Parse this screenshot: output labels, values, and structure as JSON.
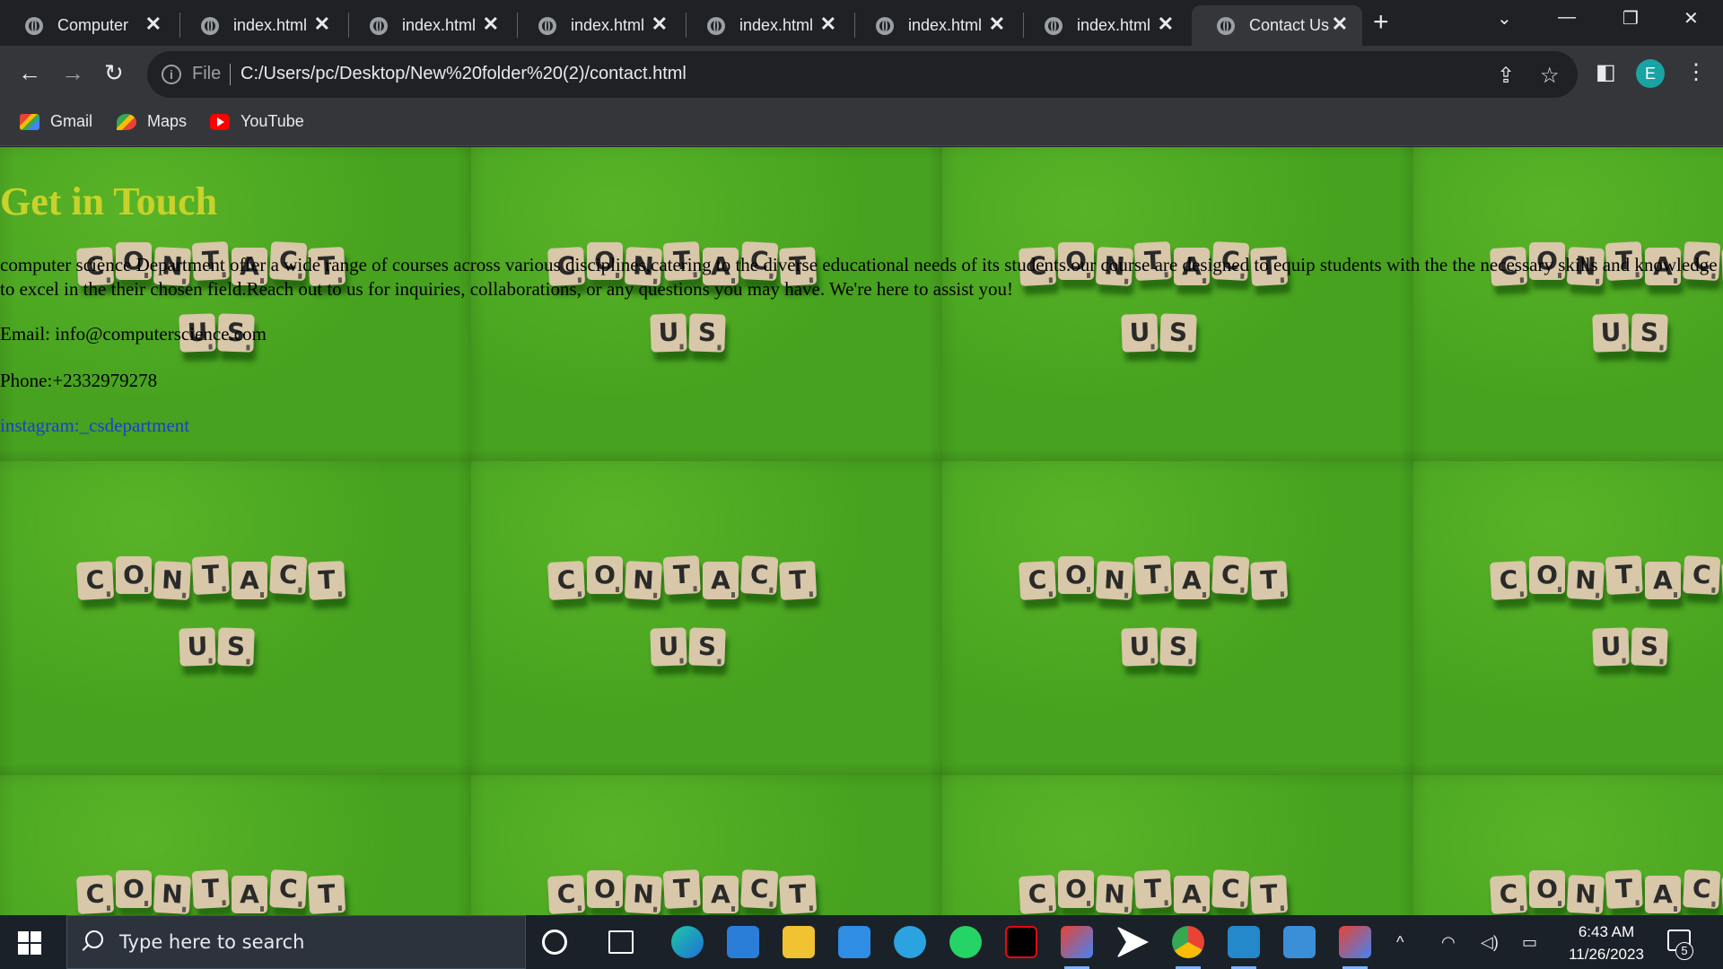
{
  "browser": {
    "tabs": [
      {
        "title": "Computer",
        "active": false
      },
      {
        "title": "index.html",
        "active": false
      },
      {
        "title": "index.html",
        "active": false
      },
      {
        "title": "index.html",
        "active": false
      },
      {
        "title": "index.html",
        "active": false
      },
      {
        "title": "index.html",
        "active": false
      },
      {
        "title": "index.html",
        "active": false
      },
      {
        "title": "Contact Us",
        "active": true
      }
    ],
    "new_tab_label": "+",
    "address": {
      "scheme_label": "File",
      "url": "C:/Users/pc/Desktop/New%20folder%20(2)/contact.html"
    },
    "profile_initial": "E",
    "bookmarks": [
      {
        "label": "Gmail",
        "icon": "gmail-icon"
      },
      {
        "label": "Maps",
        "icon": "maps-icon"
      },
      {
        "label": "YouTube",
        "icon": "youtube-icon"
      }
    ]
  },
  "page": {
    "heading": "Get in Touch",
    "intro": "computer science Department offer a wide range of courses across various disciplines,catering to the diverse educational needs of its students.our course are designed to equip students with the the necessary skills and knowledge to excel in the their chosen field.Reach out to us for inquiries, collaborations, or any questions you may have. We're here to assist you!",
    "email": "Email: info@computerscience.com",
    "phone": "Phone:+2332979278",
    "instagram": "instagram:_csdepartment",
    "background_tiles": {
      "word1": [
        "C",
        "O",
        "N",
        "T",
        "A",
        "C",
        "T"
      ],
      "word2": [
        "U",
        "S"
      ]
    }
  },
  "taskbar": {
    "search_placeholder": "Type here to search",
    "time": "6:43 AM",
    "date": "11/26/2023",
    "notification_count": "5"
  }
}
